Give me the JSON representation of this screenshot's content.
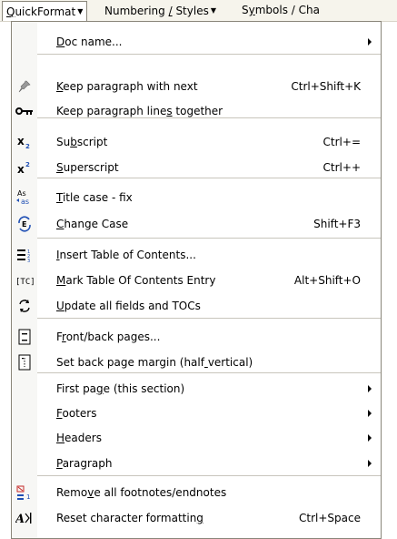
{
  "menubar": {
    "items": [
      {
        "label": "QuickFormat",
        "underline": "Q",
        "dropdown": true,
        "active": true
      },
      {
        "label": "Numbering / Styles",
        "underline": "/",
        "dropdown": true,
        "active": false
      },
      {
        "label": "Symbols / Cha",
        "underline": "y",
        "dropdown": false,
        "active": false
      }
    ]
  },
  "menu": {
    "items": [
      {
        "label": "Doc name...",
        "underline_index": 0,
        "shortcut": "",
        "submenu": true,
        "icon": "none-icon"
      },
      {
        "label": "Keep paragraph with next",
        "underline_index": 0,
        "shortcut": "Ctrl+Shift+K",
        "submenu": false,
        "icon": "pin-icon"
      },
      {
        "label": "Keep paragraph lines together",
        "underline_index": 19,
        "shortcut": "",
        "submenu": false,
        "icon": "key-icon"
      },
      {
        "label": "Subscript",
        "underline_index": 2,
        "shortcut": "Ctrl+=",
        "submenu": false,
        "icon": "subscript-icon"
      },
      {
        "label": "Superscript",
        "underline_index": 0,
        "shortcut": "Ctrl++",
        "submenu": false,
        "icon": "superscript-icon"
      },
      {
        "label": "Title case - fix",
        "underline_index": 0,
        "shortcut": "",
        "submenu": false,
        "icon": "title-case-icon"
      },
      {
        "label": "Change Case",
        "underline_index": 0,
        "shortcut": "Shift+F3",
        "submenu": false,
        "icon": "change-case-icon"
      },
      {
        "label": "Insert Table of Contents...",
        "underline_index": 0,
        "shortcut": "",
        "submenu": false,
        "icon": "toc-icon"
      },
      {
        "label": "Mark Table Of Contents Entry",
        "underline_index": 0,
        "shortcut": "Alt+Shift+O",
        "submenu": false,
        "icon": "mark-entry-icon"
      },
      {
        "label": "Update all fields and TOCs",
        "underline_index": 0,
        "shortcut": "",
        "submenu": false,
        "icon": "refresh-icon"
      },
      {
        "label": "Front/back pages...",
        "underline_index": 1,
        "shortcut": "",
        "submenu": false,
        "icon": "page-icon"
      },
      {
        "label": "Set back page margin (half vertical)",
        "underline_index": 26,
        "shortcut": "",
        "submenu": false,
        "icon": "margin-page-icon"
      },
      {
        "label": "First page (this section)",
        "underline_index": 8,
        "shortcut": "",
        "submenu": true,
        "icon": "none-icon"
      },
      {
        "label": "Footers",
        "underline_index": 0,
        "shortcut": "",
        "submenu": true,
        "icon": "none-icon"
      },
      {
        "label": "Headers",
        "underline_index": 0,
        "shortcut": "",
        "submenu": true,
        "icon": "none-icon"
      },
      {
        "label": "Paragraph",
        "underline_index": 0,
        "shortcut": "",
        "submenu": true,
        "icon": "none-icon"
      },
      {
        "label": "Remove all footnotes/endnotes",
        "underline_index": 4,
        "shortcut": "",
        "submenu": false,
        "icon": "footnote-icon"
      },
      {
        "label": "Reset character formatting",
        "underline_index": 25,
        "shortcut": "Ctrl+Space",
        "submenu": false,
        "icon": "reset-format-icon"
      }
    ]
  },
  "colors": {
    "menubar_bg": "#f6f4ec",
    "menu_border": "#8a867a",
    "separator": "#c8c5bc",
    "icon_accent_blue": "#1f4fb4",
    "icon_accent_red": "#c62828"
  }
}
